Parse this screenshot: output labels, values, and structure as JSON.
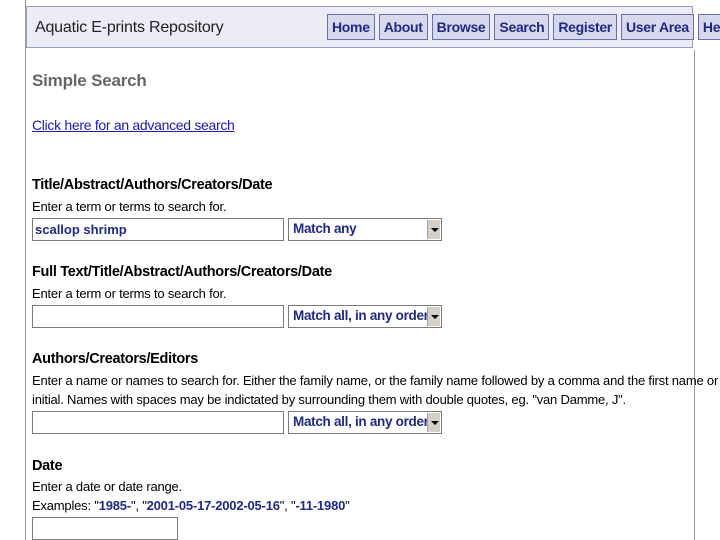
{
  "header": {
    "site_title": "Aquatic E-prints Repository",
    "nav": [
      "Home",
      "About",
      "Browse",
      "Search",
      "Register",
      "User Area",
      "Help"
    ]
  },
  "page": {
    "title": "Simple Search",
    "advanced_link": "Click here for an advanced search"
  },
  "fields": {
    "title_search": {
      "label": "Title/Abstract/Authors/Creators/Date",
      "hint": "Enter a term or terms to search for.",
      "value": "scallop shrimp",
      "match": "Match any"
    },
    "fulltext_search": {
      "label": "Full Text/Title/Abstract/Authors/Creators/Date",
      "hint": "Enter a term or terms to search for.",
      "value": "",
      "match": "Match all, in any order"
    },
    "authors_search": {
      "label": "Authors/Creators/Editors",
      "hint_line1": "Enter a name or names to search for. Either the family name, or the family name followed by a comma and the first name or",
      "hint_line2": "initial. Names with spaces may be indictated by surrounding them with double quotes, eg. \"van Damme, J\".",
      "value": "",
      "match": "Match all, in any order"
    },
    "date_search": {
      "label": "Date",
      "hint": "Enter a date or date range.",
      "examples_prefix": "Examples: \"",
      "example_1": "1985-",
      "sep_1": "\", \"",
      "example_2": "2001-05-17-2002-05-16",
      "sep_2": "\", \"",
      "example_3": "-11-1980",
      "examples_suffix": "\"",
      "value": ""
    }
  }
}
